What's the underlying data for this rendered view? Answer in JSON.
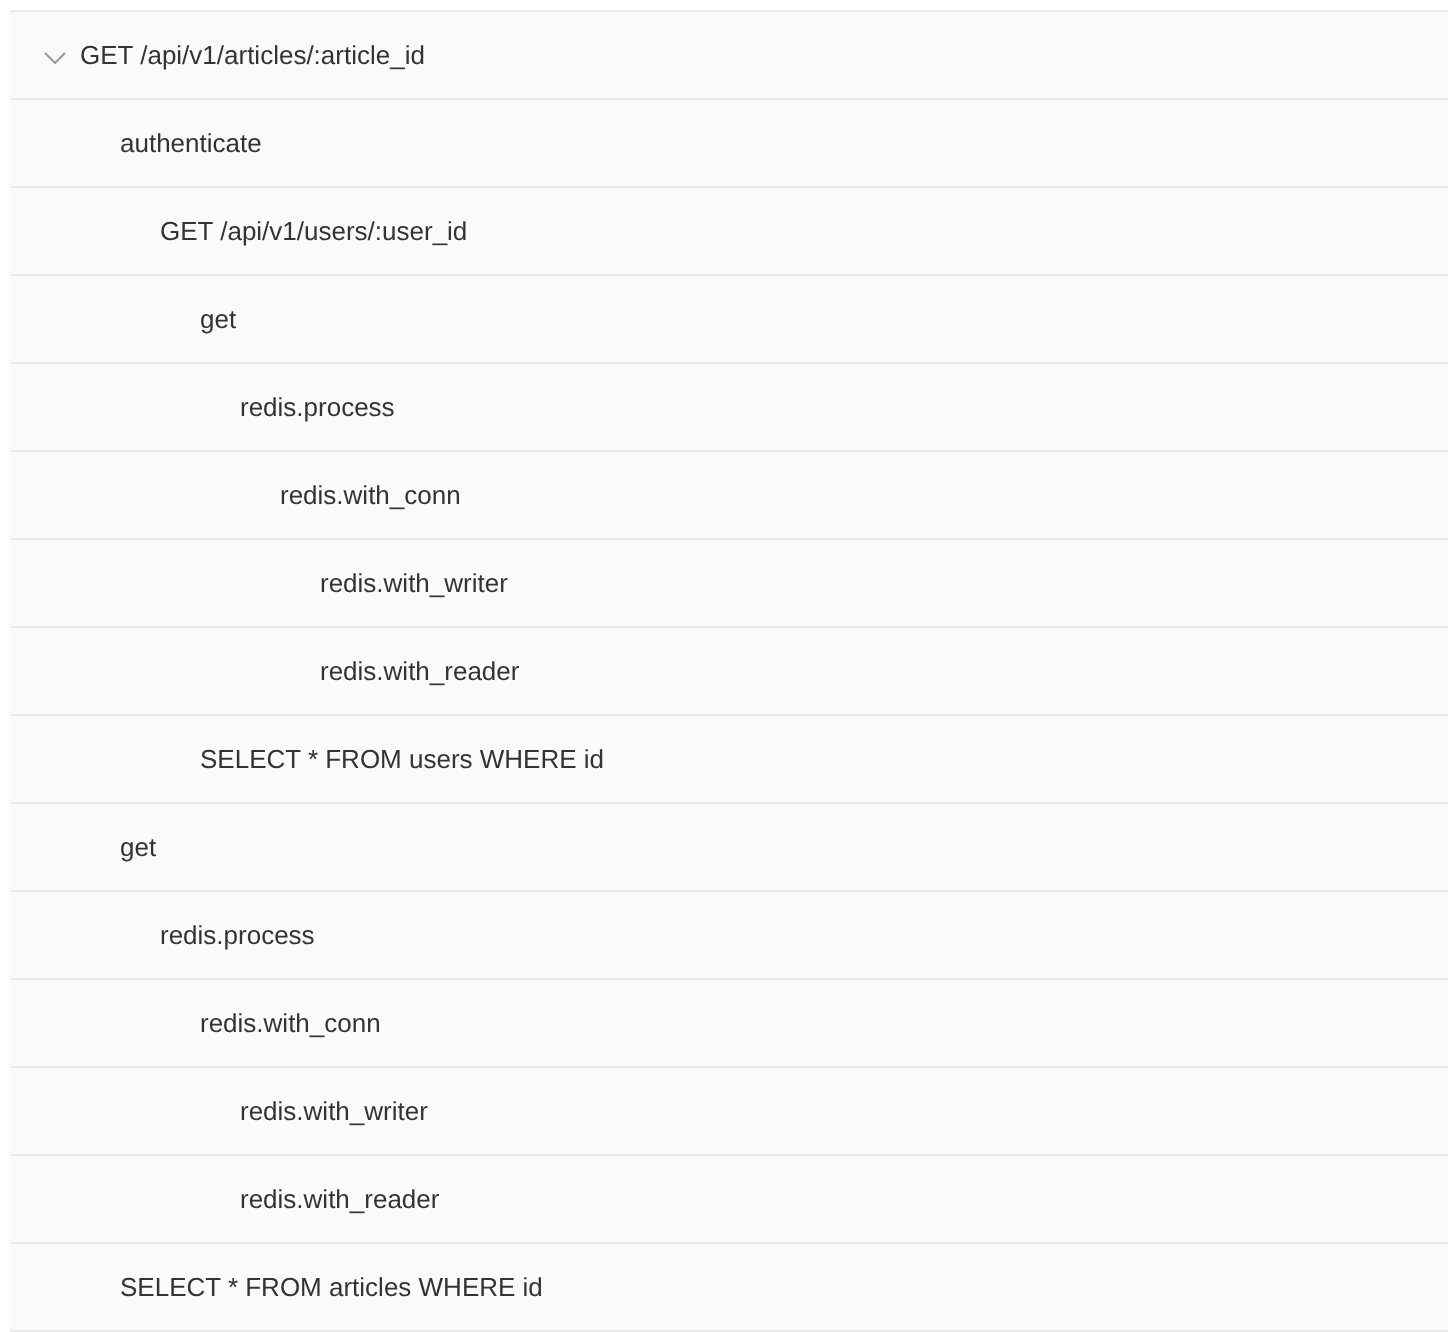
{
  "tree": [
    {
      "label": "GET /api/v1/articles/:article_id",
      "expanded": true,
      "children": [
        {
          "label": "authenticate",
          "children": [
            {
              "label": "GET /api/v1/users/:user_id",
              "children": [
                {
                  "label": "get",
                  "children": [
                    {
                      "label": "redis.process",
                      "children": [
                        {
                          "label": "redis.with_conn",
                          "children": [
                            {
                              "label": "redis.with_writer"
                            },
                            {
                              "label": "redis.with_reader"
                            }
                          ]
                        }
                      ]
                    }
                  ]
                },
                {
                  "label": "SELECT * FROM users WHERE id"
                }
              ]
            }
          ]
        },
        {
          "label": "get",
          "children": [
            {
              "label": "redis.process",
              "children": [
                {
                  "label": "redis.with_conn",
                  "children": [
                    {
                      "label": "redis.with_writer"
                    },
                    {
                      "label": "redis.with_reader"
                    }
                  ]
                }
              ]
            }
          ]
        },
        {
          "label": "SELECT * FROM articles WHERE id"
        }
      ]
    }
  ]
}
